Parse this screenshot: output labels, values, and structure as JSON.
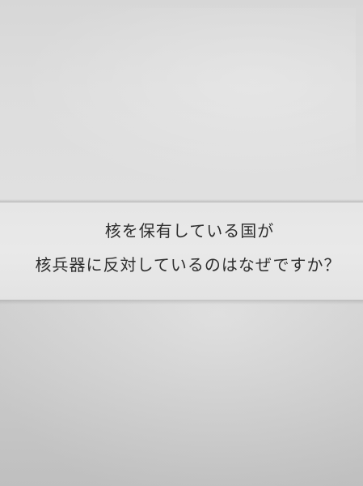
{
  "paper_text": {
    "line1": "核を保有している国が",
    "line2": "核兵器に反対しているのはなぜですか？"
  }
}
